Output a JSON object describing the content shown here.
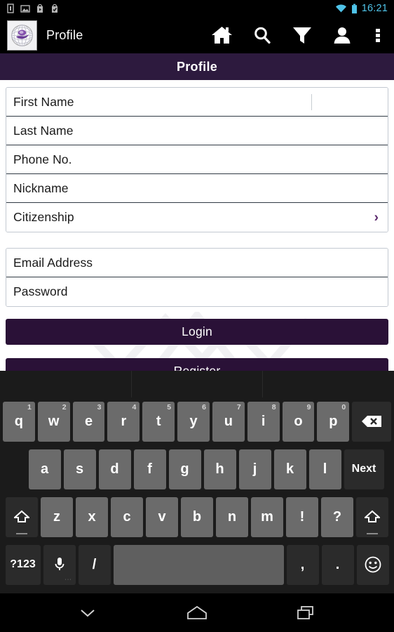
{
  "status_bar": {
    "time": "16:21",
    "left_icons": [
      "sim-card-icon",
      "photo-icon",
      "play-store-icon",
      "checkmark-bag-icon"
    ],
    "right_icons": [
      "wifi-icon",
      "battery-icon"
    ],
    "accent_color": "#4fc3e8"
  },
  "action_bar": {
    "logo": "app-logo-globe",
    "app_title": "Profile",
    "icons": [
      {
        "name": "home-icon",
        "label": "Home"
      },
      {
        "name": "search-icon",
        "label": "Search"
      },
      {
        "name": "filter-icon",
        "label": "Filter"
      },
      {
        "name": "person-icon",
        "label": "Account"
      },
      {
        "name": "overflow-menu-icon",
        "label": "More options"
      }
    ]
  },
  "page": {
    "title": "Profile",
    "title_bar_color": "#2d1a3e"
  },
  "profile_form": {
    "fields": [
      {
        "label": "First Name",
        "value": "",
        "focused": true,
        "type": "text"
      },
      {
        "label": "Last Name",
        "value": "",
        "focused": false,
        "type": "text"
      },
      {
        "label": "Phone No.",
        "value": "",
        "focused": false,
        "type": "tel"
      },
      {
        "label": "Nickname",
        "value": "",
        "focused": false,
        "type": "text"
      },
      {
        "label": "Citizenship",
        "value": "",
        "focused": false,
        "type": "select",
        "chevron": "›"
      }
    ]
  },
  "account_form": {
    "fields": [
      {
        "label": "Email Address",
        "value": "",
        "type": "email"
      },
      {
        "label": "Password",
        "value": "",
        "type": "password"
      }
    ]
  },
  "buttons": {
    "login": "Login",
    "register": "Register",
    "color": "#2a1137"
  },
  "keyboard": {
    "row1": [
      {
        "key": "q",
        "num": "1"
      },
      {
        "key": "w",
        "num": "2"
      },
      {
        "key": "e",
        "num": "3"
      },
      {
        "key": "r",
        "num": "4"
      },
      {
        "key": "t",
        "num": "5"
      },
      {
        "key": "y",
        "num": "6"
      },
      {
        "key": "u",
        "num": "7"
      },
      {
        "key": "i",
        "num": "8"
      },
      {
        "key": "o",
        "num": "9"
      },
      {
        "key": "p",
        "num": "0"
      }
    ],
    "backspace": "backspace-icon",
    "row2": [
      "a",
      "s",
      "d",
      "f",
      "g",
      "h",
      "j",
      "k",
      "l"
    ],
    "enter_key": "Next",
    "row3": [
      {
        "key": "shift-icon"
      },
      {
        "key": "z"
      },
      {
        "key": "x"
      },
      {
        "key": "c"
      },
      {
        "key": "v"
      },
      {
        "key": "b"
      },
      {
        "key": "n"
      },
      {
        "key": "m"
      },
      {
        "key": "!"
      },
      {
        "key": "?"
      },
      {
        "key": "shift-icon"
      }
    ],
    "row4": {
      "symbols": "?123",
      "mic": "microphone-icon",
      "slash": "/",
      "space": "",
      "comma": ",",
      "period": ".",
      "emoji": "emoji-icon"
    }
  },
  "nav_bar": {
    "buttons": [
      {
        "name": "hide-keyboard-button",
        "icon": "chevron-down-icon"
      },
      {
        "name": "home-button",
        "icon": "home-pentagon-icon"
      },
      {
        "name": "recents-button",
        "icon": "recents-icon"
      }
    ]
  }
}
